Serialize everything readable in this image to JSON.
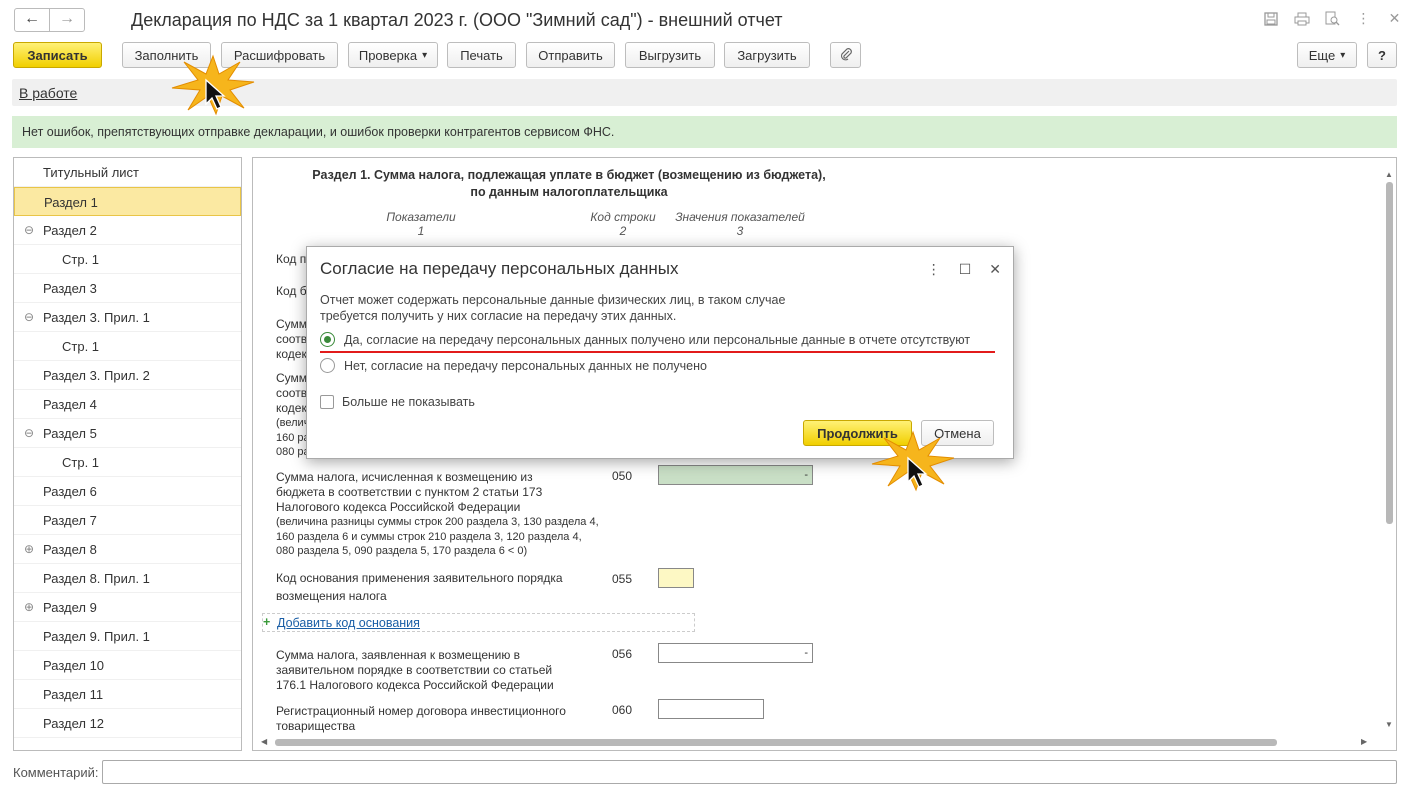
{
  "window": {
    "title": "Декларация по НДС за 1 квартал 2023 г. (ООО \"Зимний сад\") - внешний отчет",
    "back_icon": "←",
    "forward_icon": "→"
  },
  "toolbar": {
    "save": "Записать",
    "fill": "Заполнить",
    "decode": "Расшифровать",
    "check": "Проверка",
    "print": "Печать",
    "send": "Отправить",
    "export": "Выгрузить",
    "import": "Загрузить",
    "more": "Еще",
    "help": "?",
    "dropdown_arrow": "▾"
  },
  "status": {
    "link": "В работе"
  },
  "notice": "Нет ошибок, препятствующих отправке декларации, и ошибок проверки контрагентов сервисом ФНС.",
  "sidebar": {
    "items": [
      {
        "label": "Титульный лист",
        "toggle": ""
      },
      {
        "label": "Раздел 1",
        "toggle": ""
      },
      {
        "label": "Раздел 2",
        "toggle": "⊖"
      },
      {
        "label": "Стр. 1",
        "toggle": ""
      },
      {
        "label": "Раздел 3",
        "toggle": ""
      },
      {
        "label": "Раздел 3. Прил. 1",
        "toggle": "⊖"
      },
      {
        "label": "Стр. 1",
        "toggle": ""
      },
      {
        "label": "Раздел 3. Прил. 2",
        "toggle": ""
      },
      {
        "label": "Раздел 4",
        "toggle": ""
      },
      {
        "label": "Раздел 5",
        "toggle": "⊖"
      },
      {
        "label": "Стр. 1",
        "toggle": ""
      },
      {
        "label": "Раздел 6",
        "toggle": ""
      },
      {
        "label": "Раздел 7",
        "toggle": ""
      },
      {
        "label": "Раздел 8",
        "toggle": "⊕"
      },
      {
        "label": "Раздел 8. Прил. 1",
        "toggle": ""
      },
      {
        "label": "Раздел 9",
        "toggle": "⊕"
      },
      {
        "label": "Раздел 9. Прил. 1",
        "toggle": ""
      },
      {
        "label": "Раздел 10",
        "toggle": ""
      },
      {
        "label": "Раздел 11",
        "toggle": ""
      },
      {
        "label": "Раздел 12",
        "toggle": ""
      }
    ]
  },
  "main": {
    "section_title_line1": "Раздел 1. Сумма налога, подлежащая уплате в бюджет (возмещению из бюджета),",
    "section_title_line2": "по данным налогоплательщика",
    "col1": "Показатели",
    "col1_num": "1",
    "col2": "Код строки",
    "col2_num": "2",
    "col3": "Значения показателей",
    "col3_num": "3",
    "partial": {
      "r1": "Код п",
      "r2": "Код б",
      "r3a": "Сумм",
      "r3b": "соотв",
      "r3c": "кодек",
      "r4a": "Сумм",
      "r4b": "соотв",
      "r4c": "кодек",
      "r4d": "(велич",
      "r4e": "160 ра",
      "r4f": "080 ра"
    },
    "row050": {
      "label_line1": "Сумма налога, исчисленная к возмещению из",
      "label_line2": "бюджета в соответствии с пунктом 2 статьи 173",
      "label_line3": "Налогового кодекса Российской Федерации",
      "note_line1": "(величина разницы суммы строк 200 раздела 3, 130 раздела 4,",
      "note_line2": "160 раздела 6 и суммы строк 210 раздела 3, 120 раздела 4,",
      "note_line3": "080 раздела 5, 090 раздела 5, 170 раздела 6 < 0)",
      "code": "050",
      "value": "-"
    },
    "row055": {
      "label_line1": "Код основания применения заявительного порядка",
      "label_line2": "возмещения налога",
      "code": "055"
    },
    "add_code": {
      "plus": "+",
      "label": "Добавить код основания"
    },
    "row056": {
      "label_line1": "Сумма налога, заявленная к возмещению в",
      "label_line2": "заявительном порядке в соответствии со статьей",
      "label_line3": "176.1 Налогового кодекса Российской Федерации",
      "code": "056",
      "value": "-"
    },
    "row060": {
      "label_line1": "Регистрационный номер договора инвестиционного",
      "label_line2": "товарищества",
      "code": "060"
    }
  },
  "comment": {
    "label": "Комментарий:",
    "value": ""
  },
  "dialog": {
    "title": "Согласие на передачу персональных данных",
    "text_line1": "Отчет может содержать персональные данные физических лиц, в таком случае",
    "text_line2": "требуется получить у них согласие на передачу этих данных.",
    "option_yes": "Да, согласие на передачу персональных данных получено или персональные данные в отчете отсутствуют",
    "option_no": "Нет, согласие на передачу персональных данных не получено",
    "dont_show": "Больше не показывать",
    "continue": "Продолжить",
    "cancel": "Отмена",
    "selected_option": "yes"
  },
  "colors": {
    "primary_button": "#f1cf00",
    "active_nav": "#fbe9a2",
    "notice_bg": "#d8efd4",
    "highlight_underline": "#e21b1b",
    "green_field": "#c9dfc6",
    "yellow_field": "#fdf8c4"
  }
}
